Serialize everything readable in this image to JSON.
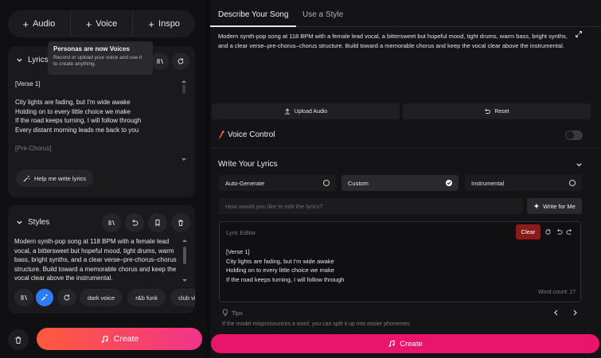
{
  "top_nav": {
    "audio": "Audio",
    "voice": "Voice",
    "inspo": "Inspo"
  },
  "tooltip": {
    "title": "Personas are now Voices",
    "body": "Record or upload your voice and use it to create anything."
  },
  "lyrics_panel": {
    "title": "Lyrics",
    "lines": [
      {
        "text": "[Verse 1]",
        "dim": false
      },
      {
        "text": "",
        "dim": false
      },
      {
        "text": "City lights are fading, but I'm wide awake",
        "dim": false
      },
      {
        "text": "Holding on to every little choice we make",
        "dim": false
      },
      {
        "text": "If the road keeps turning, I will follow through",
        "dim": false
      },
      {
        "text": "Every distant morning leads me back to you",
        "dim": false
      },
      {
        "text": "",
        "dim": false
      },
      {
        "text": "[Pre-Chorus]",
        "dim": true
      }
    ],
    "help_button": "Help me write lyrics"
  },
  "styles_panel": {
    "title": "Styles",
    "text": "Modern synth-pop song at 118 BPM with a female lead vocal, a bittersweet but hopeful mood, tight drums, warm bass, bright synths, and a clear verse–pre-chorus–chorus structure. Build toward a memorable chorus and keep the vocal clear above the instrumental.",
    "tags": [
      "dark voice",
      "r&b funk",
      "club vi"
    ]
  },
  "left_create": "Create",
  "tabs": {
    "active": "Describe Your Song",
    "inactive": "Use a Style"
  },
  "description": "Modern synth-pop song at 118 BPM with a female lead vocal, a bittersweet but hopeful mood, tight drums, warm bass, bright synths, and a clear verse–pre-chorus–chorus structure. Build toward a memorable chorus and keep the vocal clear above the instrumental.",
  "upload_audio": "Upload Audio",
  "reset": "Reset",
  "voice_control": {
    "label": "Voice Control",
    "enabled": false
  },
  "write_lyrics": {
    "title": "Write Your Lyrics",
    "options": [
      {
        "label": "Auto-Generate",
        "selected": false
      },
      {
        "label": "Custom",
        "selected": true
      },
      {
        "label": "Instrumental",
        "selected": false
      }
    ],
    "prompt_placeholder": "How would you like to edit the lyrics?",
    "write_for_me": "Write for Me"
  },
  "editor": {
    "label": "Lyric Editor",
    "clear": "Clear",
    "lines": [
      "[Verse 1]",
      "City lights are fading, but I'm wide awake",
      "Holding on to every little choice we make",
      "If the road keeps turning, I will follow through"
    ],
    "word_count": "Word count: 27"
  },
  "tips": {
    "label": "Tips",
    "text": "If the model mispronounces a word, you can split it up into easier phonemes."
  },
  "main_create": "Create",
  "colors": {
    "accent_pink": "#e8156a",
    "gradient_start": "#ff5a3c",
    "gradient_end": "#f0348a",
    "highlight_blue": "#2d7cf6",
    "clear_red": "#8b1a1a",
    "voice_icon": "#ff6a3d"
  }
}
